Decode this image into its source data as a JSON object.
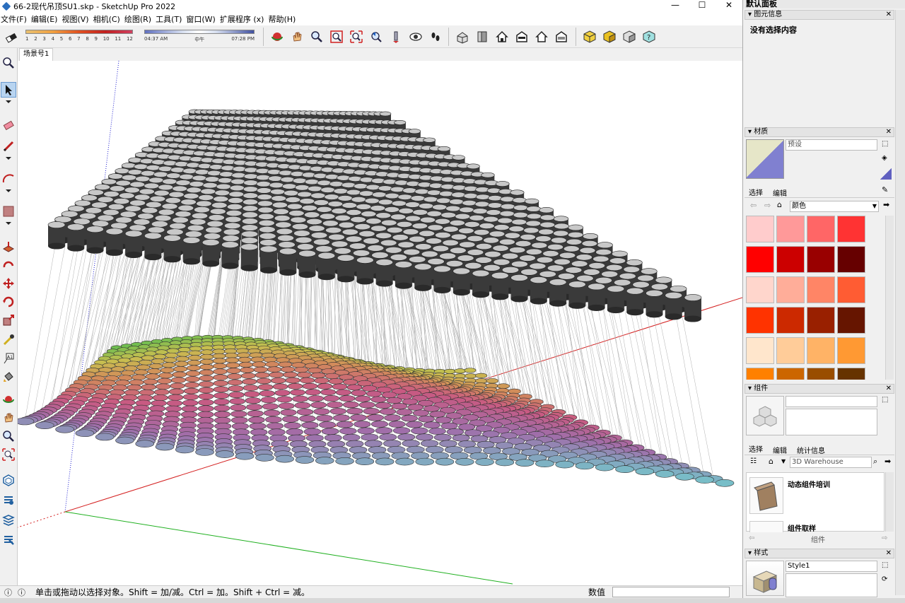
{
  "window": {
    "title": "66-2现代吊顶SU1.skp - SketchUp Pro 2022",
    "minimize": "—",
    "maximize": "☐",
    "close": "✕"
  },
  "menu": [
    "文件(F)",
    "编辑(E)",
    "视图(V)",
    "相机(C)",
    "绘图(R)",
    "工具(T)",
    "窗口(W)",
    "扩展程序 (x)",
    "帮助(H)"
  ],
  "shadow": {
    "months": [
      "1",
      "2",
      "3",
      "4",
      "5",
      "6",
      "7",
      "8",
      "9",
      "10",
      "11",
      "12"
    ],
    "time_start": "04:37 AM",
    "time_mid": "中午",
    "time_end": "07:28 PM"
  },
  "scene_tab": "场景号1",
  "status": {
    "hint": "单击或拖动以选择对象。Shift = 加/减。Ctrl = 加。Shift + Ctrl = 减。",
    "value_label": "数值"
  },
  "tray": {
    "title": "默认面板",
    "entity_info": {
      "header": "图元信息",
      "text": "没有选择内容"
    },
    "materials": {
      "header": "材质",
      "name_placeholder": "预设",
      "tab_select": "选择",
      "tab_edit": "编辑",
      "library": "颜色",
      "swatches": [
        "#ffcccc",
        "#ff9999",
        "#ff6666",
        "#ff3333",
        "#ff0000",
        "#cc0000",
        "#990000",
        "#660000",
        "#ffd6cc",
        "#ffad99",
        "#ff8566",
        "#ff5c33",
        "#ff3300",
        "#cc2900",
        "#992000",
        "#661500",
        "#ffe6cc",
        "#ffcc99",
        "#ffb366",
        "#ff9933",
        "#ff8000",
        "#cc6600",
        "#994d00",
        "#663300"
      ]
    },
    "components": {
      "header": "组件",
      "tab_select": "选择",
      "tab_edit": "编辑",
      "tab_stats": "统计信息",
      "search_placeholder": "3D Warehouse",
      "items": [
        "动态组件培训",
        "组件取样"
      ],
      "footer": "组件"
    },
    "styles": {
      "header": "样式",
      "style_name": "Style1"
    }
  },
  "colors": {
    "accent_selection": "#b8d4f0",
    "axis_red": "#d42020",
    "axis_green": "#20b020",
    "axis_blue": "#2020d0"
  }
}
